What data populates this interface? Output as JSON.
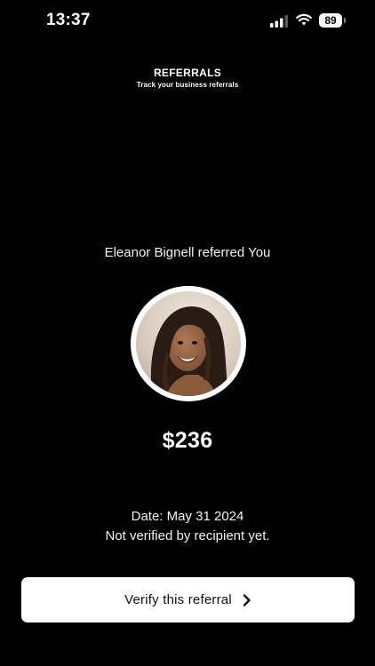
{
  "status_bar": {
    "time": "13:37",
    "battery_level": "89",
    "icons": [
      "signal-icon",
      "wifi-icon",
      "battery-icon"
    ]
  },
  "header": {
    "title": "REFERRALS",
    "subtitle": "Track your business referrals"
  },
  "referral": {
    "referrer_text": "Eleanor Bignell referred You",
    "amount": "$236",
    "date": "Date: May 31 2024",
    "status": "Not verified by recipient yet."
  },
  "action": {
    "verify_label": "Verify this referral",
    "icon": "chevron-right-icon"
  },
  "colors": {
    "background": "#000000",
    "text": "#ffffff",
    "button_bg": "#ffffff",
    "button_text": "#111111"
  }
}
